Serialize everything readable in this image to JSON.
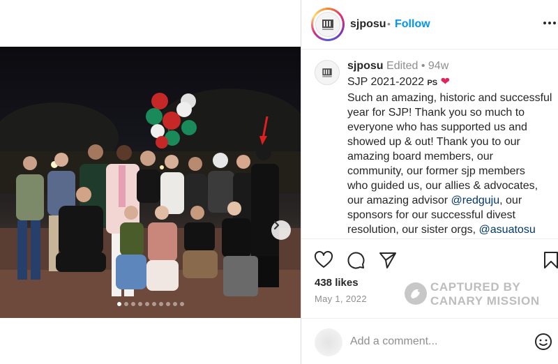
{
  "header": {
    "username": "sjposu",
    "separator": "•",
    "follow_label": "Follow",
    "more_icon": "more-options-icon"
  },
  "caption": {
    "username": "sjposu",
    "edited": "Edited",
    "separator": "•",
    "age": "94w",
    "title": "SJP 2021-2022",
    "title_tag": "PS",
    "title_emoji": "❤",
    "lines": [
      "Such an amazing, historic and successful",
      "year for SJP! Thank you so much to",
      "everyone who has supported us and",
      "showed up & out! Thank you to our",
      "amazing board members, our",
      "community, our former sjp members",
      "who guided us, our allies & advocates,"
    ],
    "line_advisor_prefix": "our amazing advisor ",
    "mention_advisor": "@redguju",
    "line_advisor_suffix": ", our",
    "line_sponsors": "sponsors for our successful divest",
    "line_resolution": "resolution, our sister orgs, ",
    "mention_sister": "@asuatosu"
  },
  "actions": {
    "like_icon": "heart-icon",
    "comment_icon": "comment-icon",
    "share_icon": "share-icon",
    "save_icon": "bookmark-icon"
  },
  "likes": "438 likes",
  "date": "May 1, 2022",
  "watermark": {
    "line1": "CAPTURED BY",
    "line2": "CANARY MISSION"
  },
  "comment": {
    "placeholder": "Add a comment...",
    "emoji_icon": "emoji-icon"
  },
  "carousel": {
    "total_slides": 10,
    "active_index": 0
  },
  "colors": {
    "follow_blue": "#0095f6",
    "mention_blue": "#00376b",
    "muted_gray": "#8e8e8e",
    "heart_red": "#e0245e"
  }
}
